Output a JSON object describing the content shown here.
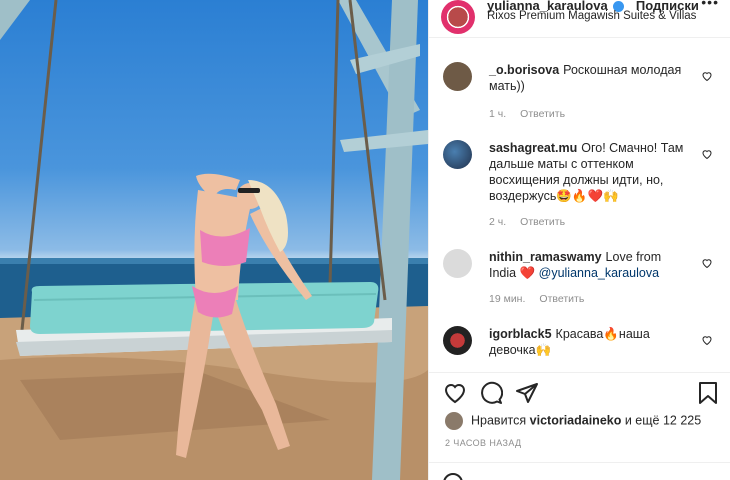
{
  "post": {
    "username": "yulianna_karaulova",
    "follow_label": "Подписки",
    "location": "Rixos Premium Magawish Suites & Villas",
    "more_label": "•••"
  },
  "comments": [
    {
      "user": "_o.borisova",
      "text": "Роскошная молодая мать))",
      "time": "1 ч.",
      "reply": "Ответить"
    },
    {
      "user": "sashagreat.mu",
      "text": "Ого! Смачно! Там дальше маты с оттенком восхищения должны идти, но, воздержусь🤩🔥❤️🙌",
      "time": "2 ч.",
      "reply": "Ответить"
    },
    {
      "user": "nithin_ramaswamy",
      "text": "Love from India ❤️",
      "mention": "@yulianna_karaulova",
      "time": "19 мин.",
      "reply": "Ответить"
    },
    {
      "user": "igorblack5",
      "text": "Красава🔥наша девочка🙌"
    }
  ],
  "likes": {
    "prefix": "Нравится",
    "liker": "victoriadaineko",
    "suffix": "и ещё 12 225"
  },
  "time_ago": "2 ЧАСОВ НАЗАД",
  "icons": {
    "like": "heart-icon",
    "comment": "comment-icon",
    "share": "paper-plane-icon",
    "save": "bookmark-icon"
  },
  "colors": {
    "sky": "#2b7fd3",
    "sea": "#1e5f8e",
    "sand": "#c8a27a",
    "cushion": "#7ed3cf",
    "bikini": "#ec7fb8",
    "swing_frame": "#9fbfc8",
    "like_red": "#ed4956",
    "mention": "#00376b",
    "meta_gray": "#8e8e8e"
  }
}
